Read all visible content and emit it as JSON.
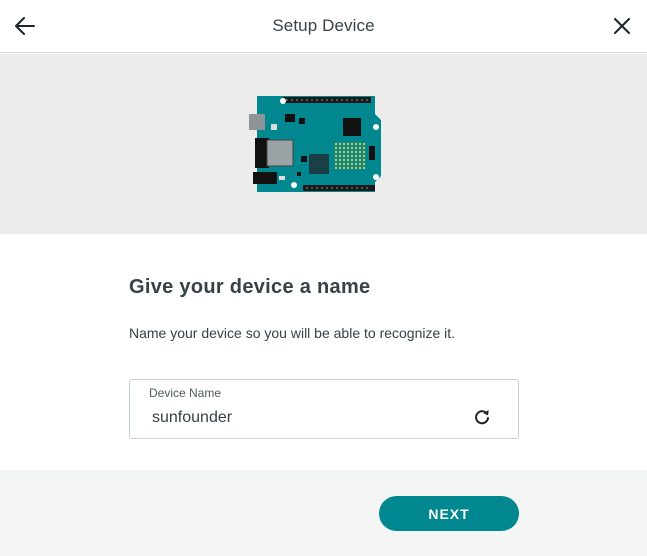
{
  "header": {
    "title": "Setup Device",
    "back_icon": "arrow-left-icon",
    "close_icon": "close-icon"
  },
  "illustration": {
    "icon": "arduino-board-icon",
    "board_color": "#00878f"
  },
  "main": {
    "heading": "Give your device a name",
    "description": "Name your device so you will be able to recognize it.",
    "device_name_field": {
      "label": "Device Name",
      "value": "sunfounder",
      "refresh_icon": "refresh-icon"
    }
  },
  "footer": {
    "next_label": "NEXT",
    "accent_color": "#00878f"
  }
}
